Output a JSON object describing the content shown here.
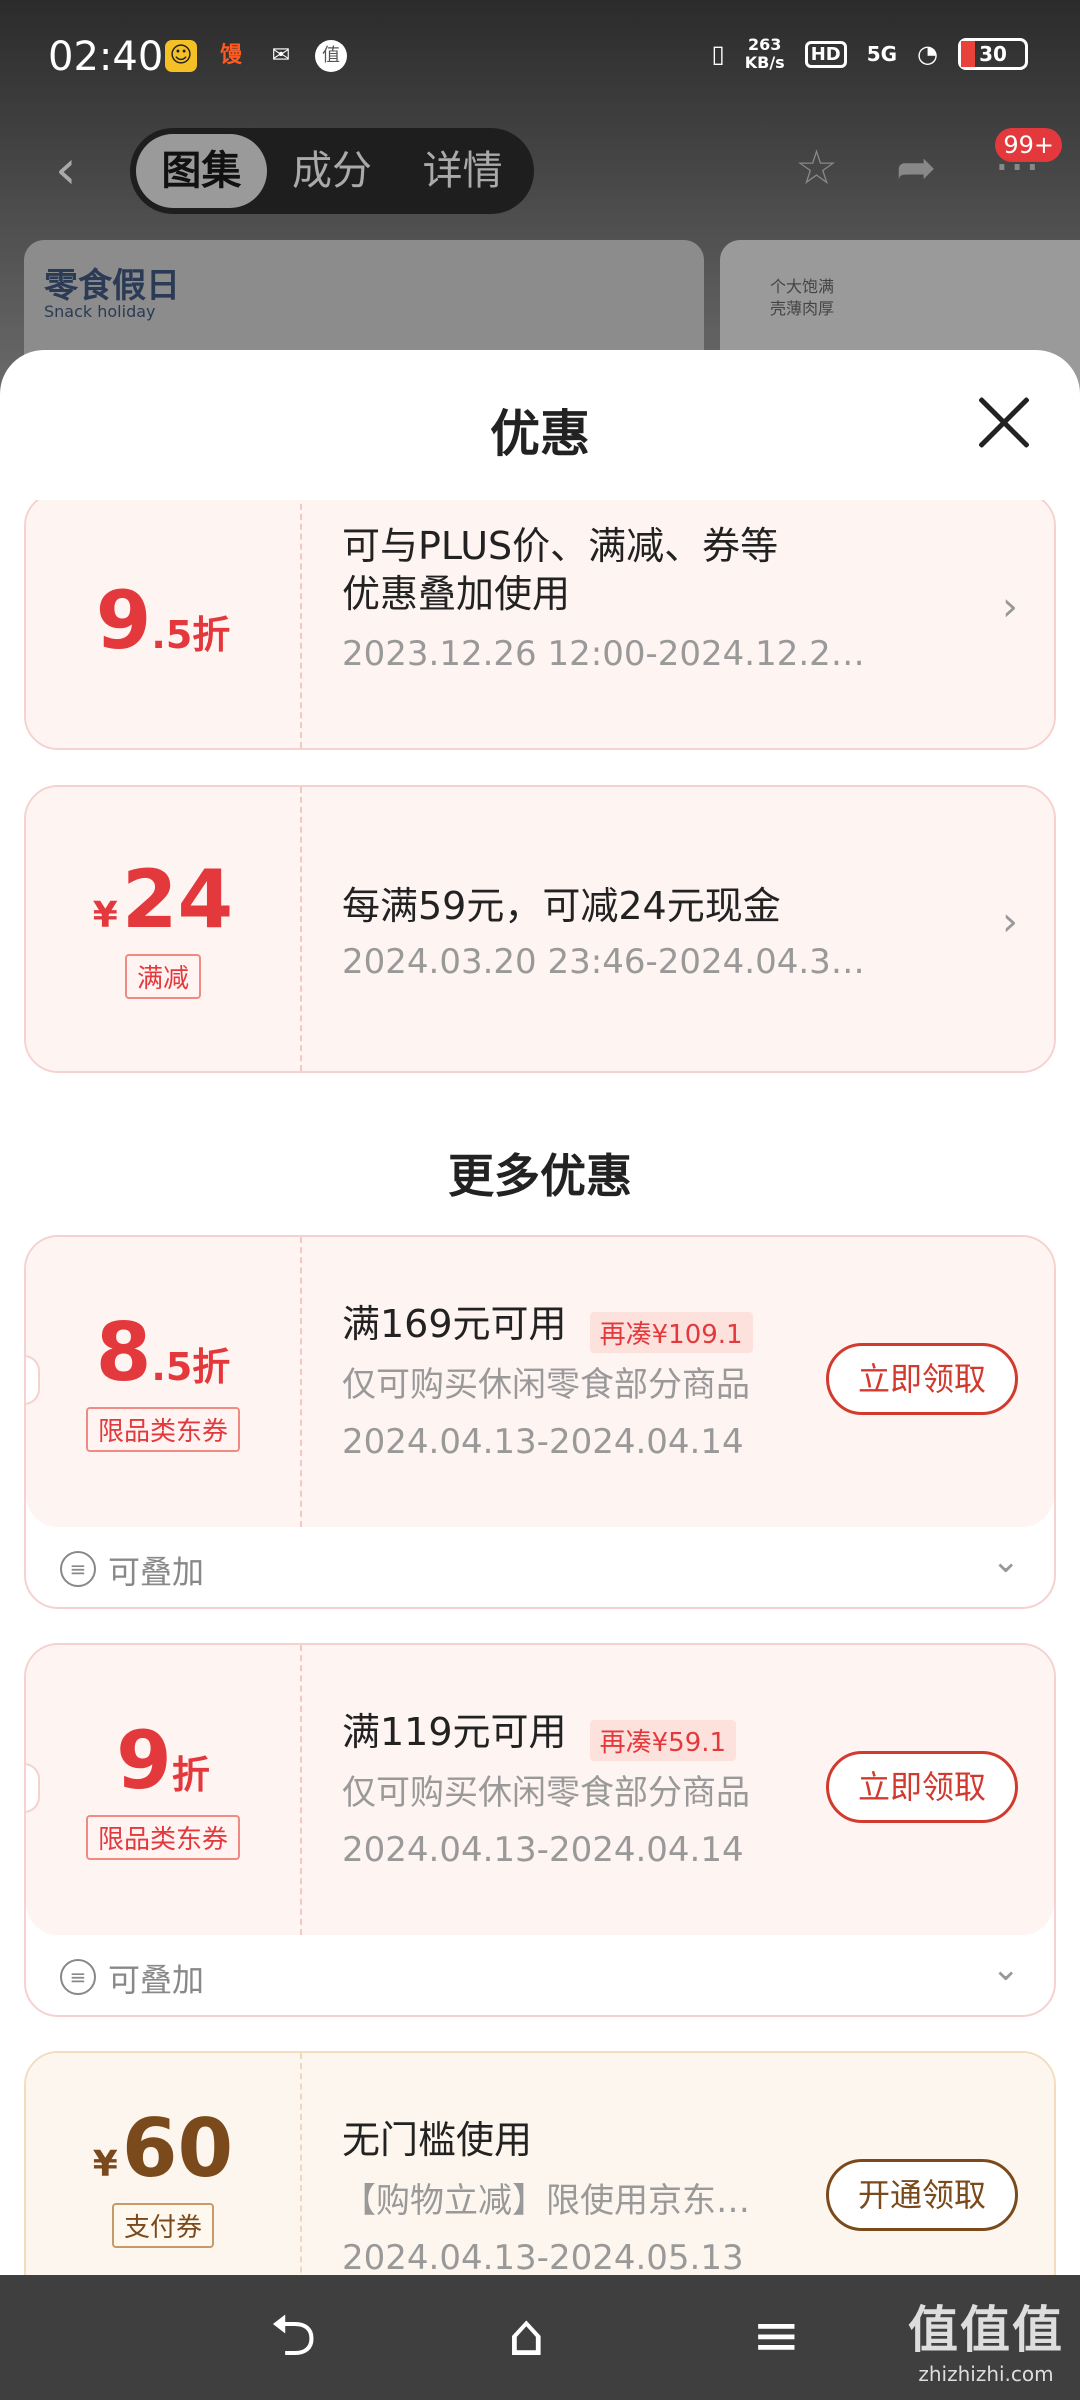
{
  "status_bar": {
    "time": "02:40",
    "net_speed_value": "263",
    "net_speed_unit": "KB/s",
    "hd": "HD",
    "network": "5G",
    "battery": "30",
    "notif_red": "馒",
    "notif_zhi": "值"
  },
  "nav": {
    "tabs": [
      "图集",
      "成分",
      "详情"
    ],
    "active_tab": "图集",
    "badge": "99+"
  },
  "product": {
    "brand": "零食假日",
    "brand_en": "Snack holiday",
    "card2_line1": "个大饱满",
    "card2_line2": "壳薄肉厚"
  },
  "sheet": {
    "title": "优惠",
    "coupons_top": [
      {
        "amount_big": "9",
        "amount_small": ".5折",
        "title_line1": "可与PLUS价、满减、券等",
        "title_line2": "优惠叠加使用",
        "date": "2023.12.26 12:00-2024.12.2…"
      },
      {
        "yen": "¥",
        "amount_big": "24",
        "tag": "满减",
        "title_line1": "每满59元，可减24元现金",
        "date": "2024.03.20 23:46-2024.04.3…"
      }
    ],
    "more_title": "更多优惠",
    "coupons_more": [
      {
        "amount_big": "8",
        "amount_small": ".5折",
        "tag": "限品类东券",
        "title": "满169元可用",
        "need": "再凑¥109.1",
        "desc": "仅可购买休闲零食部分商品",
        "date": "2024.04.13-2024.04.14",
        "button": "立即领取",
        "stack_label": "可叠加"
      },
      {
        "amount_big": "9",
        "amount_small": "折",
        "tag": "限品类东券",
        "title": "满119元可用",
        "need": "再凑¥59.1",
        "desc": "仅可购买休闲零食部分商品",
        "date": "2024.04.13-2024.04.14",
        "button": "立即领取",
        "stack_label": "可叠加"
      },
      {
        "yen": "¥",
        "amount_big": "60",
        "tag": "支付券",
        "title": "无门槛使用",
        "desc": "【购物立减】限使用京东…",
        "date": "2024.04.13-2024.05.13",
        "button": "开通领取"
      }
    ]
  },
  "watermark": {
    "main": "值值值",
    "sub": "zhizhizhi.com"
  },
  "colors": {
    "accent_red": "#e4393c",
    "pay_brown": "#7a4a1c",
    "coupon_bg": "#fef4f2"
  }
}
